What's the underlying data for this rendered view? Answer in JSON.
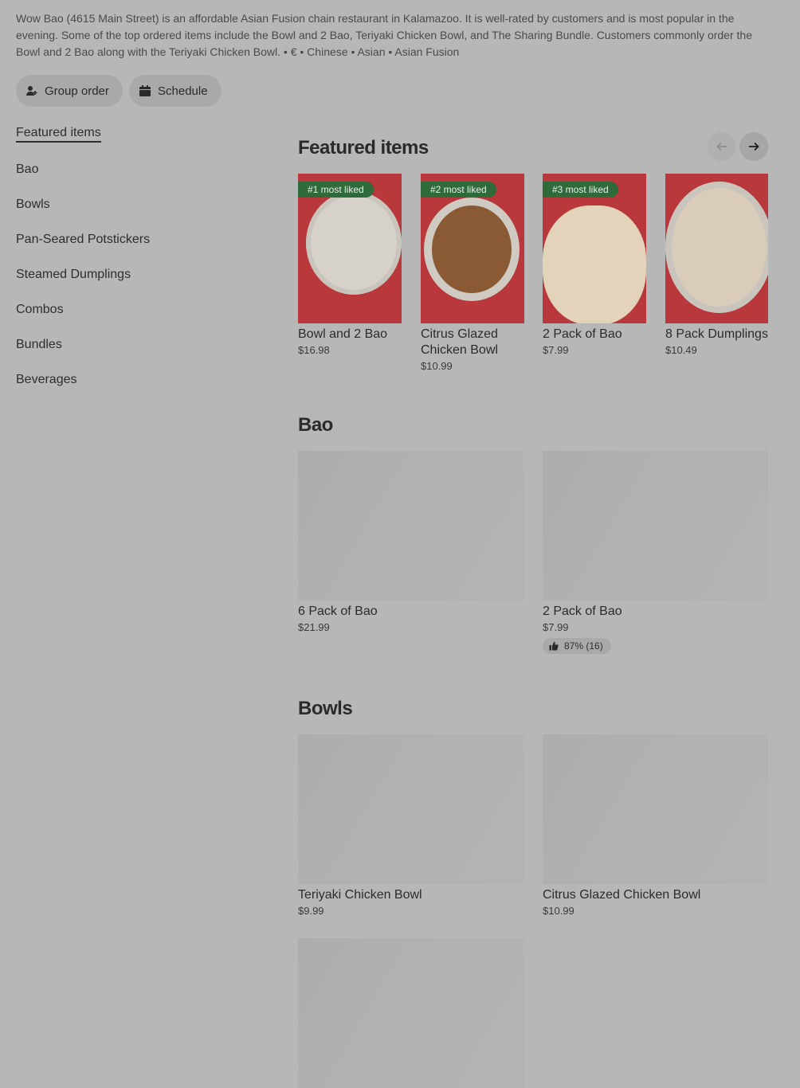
{
  "store": {
    "description": "Wow Bao (4615 Main Street) is an affordable Asian Fusion chain restaurant in Kalamazoo. It is well-rated by customers and is most popular in the evening. Some of the top ordered items include the Bowl and 2 Bao, Teriyaki Chicken Bowl, and The Sharing Bundle. Customers commonly order the Bowl and 2 Bao along with the Teriyaki Chicken Bowl. • € • Chinese • Asian • Asian Fusion"
  },
  "actions": {
    "group_order": "Group order",
    "schedule": "Schedule"
  },
  "sidebar": {
    "items": [
      {
        "label": "Featured items"
      },
      {
        "label": "Bao"
      },
      {
        "label": "Bowls"
      },
      {
        "label": "Pan-Seared Potstickers"
      },
      {
        "label": "Steamed Dumplings"
      },
      {
        "label": "Combos"
      },
      {
        "label": "Bundles"
      },
      {
        "label": "Beverages"
      }
    ]
  },
  "featured": {
    "title": "Featured items",
    "items": [
      {
        "badge": "#1 most liked",
        "name": "Bowl and 2 Bao",
        "price": "$16.98"
      },
      {
        "badge": "#2 most liked",
        "name": "Citrus Glazed Chicken Bowl",
        "price": "$10.99"
      },
      {
        "badge": "#3 most liked",
        "name": "2 Pack of Bao",
        "price": "$7.99"
      },
      {
        "badge": "",
        "name": "8 Pack Dumplings",
        "price": "$10.49"
      }
    ]
  },
  "bao": {
    "title": "Bao",
    "items": [
      {
        "name": "6 Pack of Bao",
        "price": "$21.99"
      },
      {
        "name": "2 Pack of Bao",
        "price": "$7.99",
        "rating": "87% (16)"
      }
    ]
  },
  "bowls": {
    "title": "Bowls",
    "items": [
      {
        "name": "Teriyaki Chicken Bowl",
        "price": "$9.99"
      },
      {
        "name": "Citrus Glazed Chicken Bowl",
        "price": "$10.99"
      }
    ]
  },
  "colors": {
    "overlay_bg": "#b7b7b7",
    "badge_green": "#2f6a3a",
    "food_red": "#b8383c"
  }
}
